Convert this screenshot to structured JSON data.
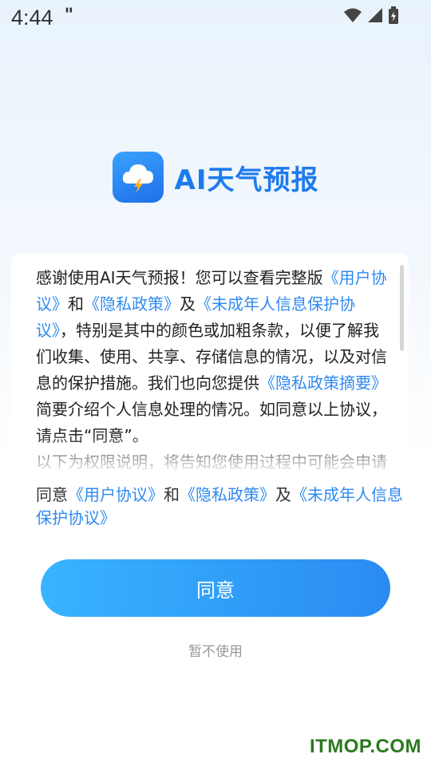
{
  "status_bar": {
    "time": "4:44",
    "notification": "\"",
    "icons": [
      "wifi-icon",
      "signal-icon",
      "battery-charging-icon"
    ]
  },
  "brand": {
    "icon": "cloud-lightning-icon",
    "name": "AI天气预报"
  },
  "privacy_card": {
    "segments": [
      {
        "text": "感谢使用AI天气预报！您可以查看完整版",
        "link": false
      },
      {
        "text": "《用户协议》",
        "link": true
      },
      {
        "text": "和",
        "link": false
      },
      {
        "text": "《隐私政策》",
        "link": true
      },
      {
        "text": "及",
        "link": false
      },
      {
        "text": "《未成年人信息保护协议》",
        "link": true
      },
      {
        "text": "，特别是其中的颜色或加粗条款，以便了解我们收集、使用、共享、存储信息的情况，以及对信息的保护措施。我们也向您提供",
        "link": false
      },
      {
        "text": "《隐私政策摘要》",
        "link": true
      },
      {
        "text": "简要介绍个人信息处理的情况。如同意以上协议，请点击“同意”。",
        "link": false
      },
      {
        "text": "以下为权限说明，将告知您使用过程中可能会申请",
        "link": false
      }
    ]
  },
  "agreement_line": {
    "prefix": "同意",
    "user_agreement": "《用户协议》",
    "and": "和",
    "privacy_policy": "《隐私政策》",
    "and2": "及",
    "minor_protection": "《未成年人信息保护协议》"
  },
  "actions": {
    "agree_label": "同意",
    "decline_label": "暂不使用"
  },
  "watermark": "ITMOP.COM",
  "colors": {
    "accent": "#2f8af0",
    "button_start": "#38b4ff",
    "button_end": "#2a8bf2",
    "watermark": "#2a7a1e"
  }
}
